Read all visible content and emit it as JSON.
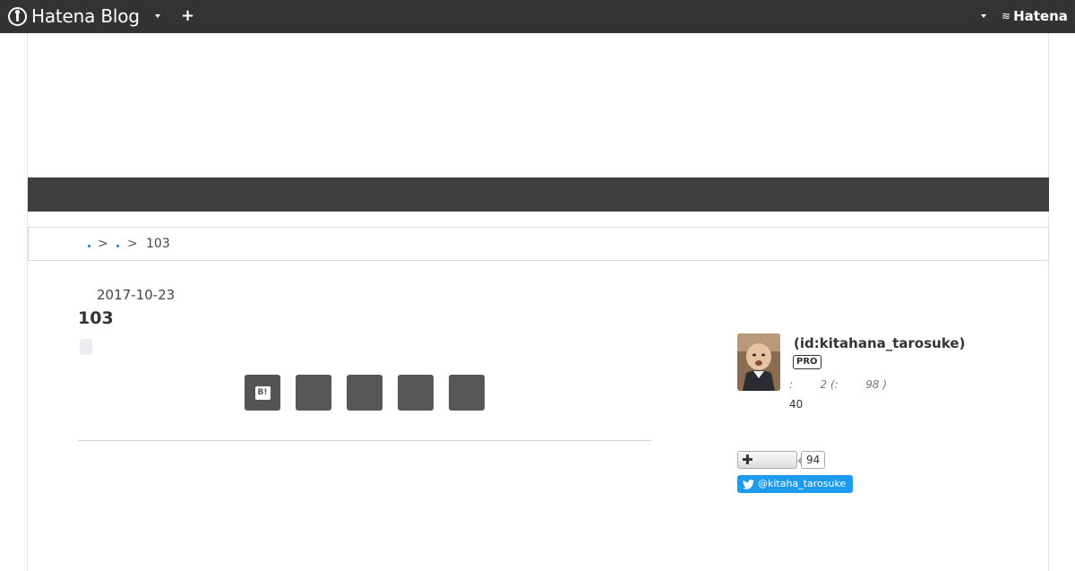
{
  "header": {
    "logo_text": "Hatena Blog",
    "brand_text": "Hatena"
  },
  "breadcrumb": {
    "separator": ">",
    "current": "103"
  },
  "entry": {
    "date": "2017-10-23",
    "title": "103",
    "share_buttons": [
      {
        "name": "hatena-bookmark",
        "label": "B!"
      },
      {
        "name": "facebook"
      },
      {
        "name": "twitter"
      },
      {
        "name": "line"
      },
      {
        "name": "pocket"
      }
    ]
  },
  "profile": {
    "id_text": "(id:kitahana_tarosuke)",
    "badge": "PRO",
    "stats_text": ":        2 (:        98 )",
    "count_text": "40",
    "follow_count": "94",
    "twitter_handle": "@kitaha_tarosuke"
  },
  "colors": {
    "header_bg": "#333333",
    "navbar_bg": "#3f3f3f",
    "share_btn": "#575757",
    "twitter_blue": "#1d9bf0"
  }
}
